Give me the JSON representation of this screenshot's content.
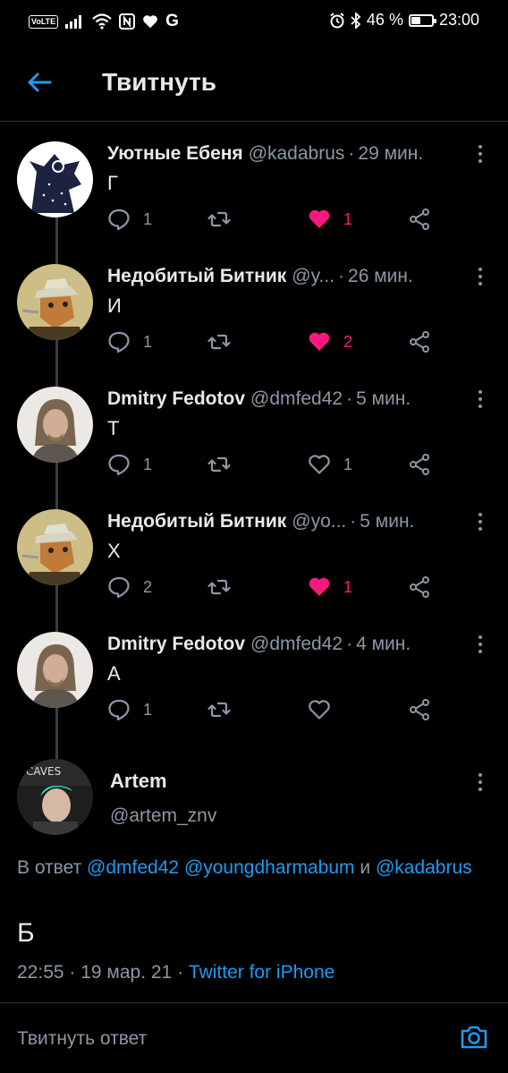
{
  "status_bar": {
    "volte": "VoLTE",
    "battery": "46 %",
    "battery_level": 0.46,
    "time": "23:00"
  },
  "header": {
    "title": "Твитнуть"
  },
  "tweets": [
    {
      "name": "Уютные Ебеня",
      "handle": "@kadabrus",
      "time": "29 мин.",
      "text": "Г",
      "replies": "1",
      "likes": "1",
      "liked": true,
      "avatar": "wolf-avatar"
    },
    {
      "name": "Недобитый Битник",
      "handle": "@y...",
      "time": "26 мин.",
      "text": "И",
      "replies": "1",
      "likes": "2",
      "liked": true,
      "avatar": "fox-avatar"
    },
    {
      "name": "Dmitry Fedotov",
      "handle": "@dmfed42",
      "time": "5 мин.",
      "text": "Т",
      "replies": "1",
      "likes": "1",
      "liked": false,
      "avatar": "man-avatar"
    },
    {
      "name": "Недобитый Битник",
      "handle": "@yo...",
      "time": "5 мин.",
      "text": "Х",
      "replies": "2",
      "likes": "1",
      "liked": true,
      "avatar": "fox-avatar"
    },
    {
      "name": "Dmitry Fedotov",
      "handle": "@dmfed42",
      "time": "4 мин.",
      "text": "А",
      "replies": "1",
      "likes": "",
      "liked": false,
      "avatar": "man-avatar"
    }
  ],
  "focused": {
    "name": "Artem",
    "handle": "@artem_znv",
    "reply_prefix": "В ответ",
    "mention_1": "@dmfed42",
    "mention_2": "@youngdharmabum",
    "reply_and": "и",
    "mention_3": "@kadabrus",
    "text": "Б",
    "timestamp": "22:55 · 19 мар. 21 ·",
    "source": "Twitter for iPhone"
  },
  "compose": {
    "placeholder": "Твитнуть ответ"
  },
  "colors": {
    "accent": "#1d9bf0",
    "like": "#f91880",
    "muted": "#8b98a5",
    "background": "#000000"
  }
}
